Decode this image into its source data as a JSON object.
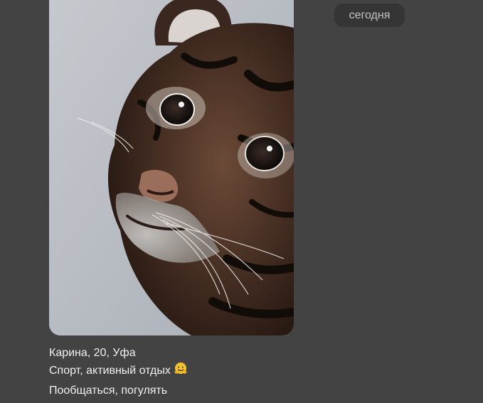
{
  "message": {
    "date_label": "сегодня",
    "photo_icon": "tiger-cub-photo",
    "caption_lines": [
      "Карина, 20, Уфа",
      "Спорт, активный отдых",
      "Пообщаться, погулять"
    ],
    "caption_emoji": "hugging-face-emoji"
  },
  "colors": {
    "background": "#434343",
    "date_pill": "#353535",
    "text": "#f1f1f1"
  }
}
